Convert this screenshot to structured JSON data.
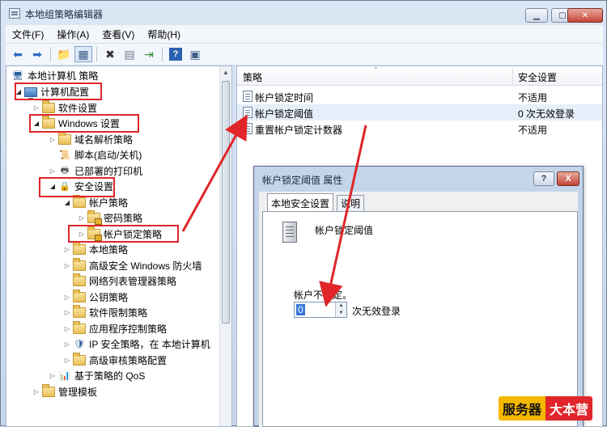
{
  "window": {
    "title": "本地组策略编辑器"
  },
  "menu": [
    "文件(F)",
    "操作(A)",
    "查看(V)",
    "帮助(H)"
  ],
  "tree": [
    {
      "label": "本地计算机 策略",
      "icon": "computer-policy-icon"
    },
    {
      "label": "计算机配置",
      "icon": "monitor-icon"
    },
    {
      "label": "软件设置",
      "icon": "folder-icon"
    },
    {
      "label": "Windows 设置",
      "icon": "folder-icon"
    },
    {
      "label": "域名解析策略",
      "icon": "folder-icon"
    },
    {
      "label": "脚本(启动/关机)",
      "icon": "script-icon"
    },
    {
      "label": "已部署的打印机",
      "icon": "printer-icon"
    },
    {
      "label": "安全设置",
      "icon": "security-icon"
    },
    {
      "label": "帐户策略",
      "icon": "folder-icon"
    },
    {
      "label": "密码策略",
      "icon": "lock-folder-icon"
    },
    {
      "label": "帐户锁定策略",
      "icon": "lock-folder-icon"
    },
    {
      "label": "本地策略",
      "icon": "folder-icon"
    },
    {
      "label": "高级安全 Windows 防火墙",
      "icon": "folder-icon"
    },
    {
      "label": "网络列表管理器策略",
      "icon": "folder-icon"
    },
    {
      "label": "公钥策略",
      "icon": "folder-icon"
    },
    {
      "label": "软件限制策略",
      "icon": "folder-icon"
    },
    {
      "label": "应用程序控制策略",
      "icon": "folder-icon"
    },
    {
      "label": "IP 安全策略，在 本地计算机",
      "icon": "ip-security-icon"
    },
    {
      "label": "高级审核策略配置",
      "icon": "folder-icon"
    },
    {
      "label": "基于策略的 QoS",
      "icon": "chart-icon"
    },
    {
      "label": "管理模板",
      "icon": "folder-icon"
    }
  ],
  "list": {
    "col_policy": "策略",
    "col_setting": "安全设置",
    "rows": [
      {
        "name": "帐户锁定时间",
        "value": "不适用"
      },
      {
        "name": "帐户锁定阈值",
        "value": "0 次无效登录"
      },
      {
        "name": "重置帐户锁定计数器",
        "value": "不适用"
      }
    ]
  },
  "dialog": {
    "title": "帐户锁定阈值 属性",
    "help_label": "?",
    "close_label": "X",
    "tab_local": "本地安全设置",
    "tab_explain": "说明",
    "policy_name": "帐户锁定阈值",
    "no_lock_label": "帐户不锁定。",
    "spin_value": "0",
    "unit_label": "次无效登录"
  },
  "watermark": {
    "part1": "服务器",
    "part2": "大本营"
  },
  "colors": {
    "highlight_box": "#e0262a",
    "arrow": "#e0262a"
  }
}
